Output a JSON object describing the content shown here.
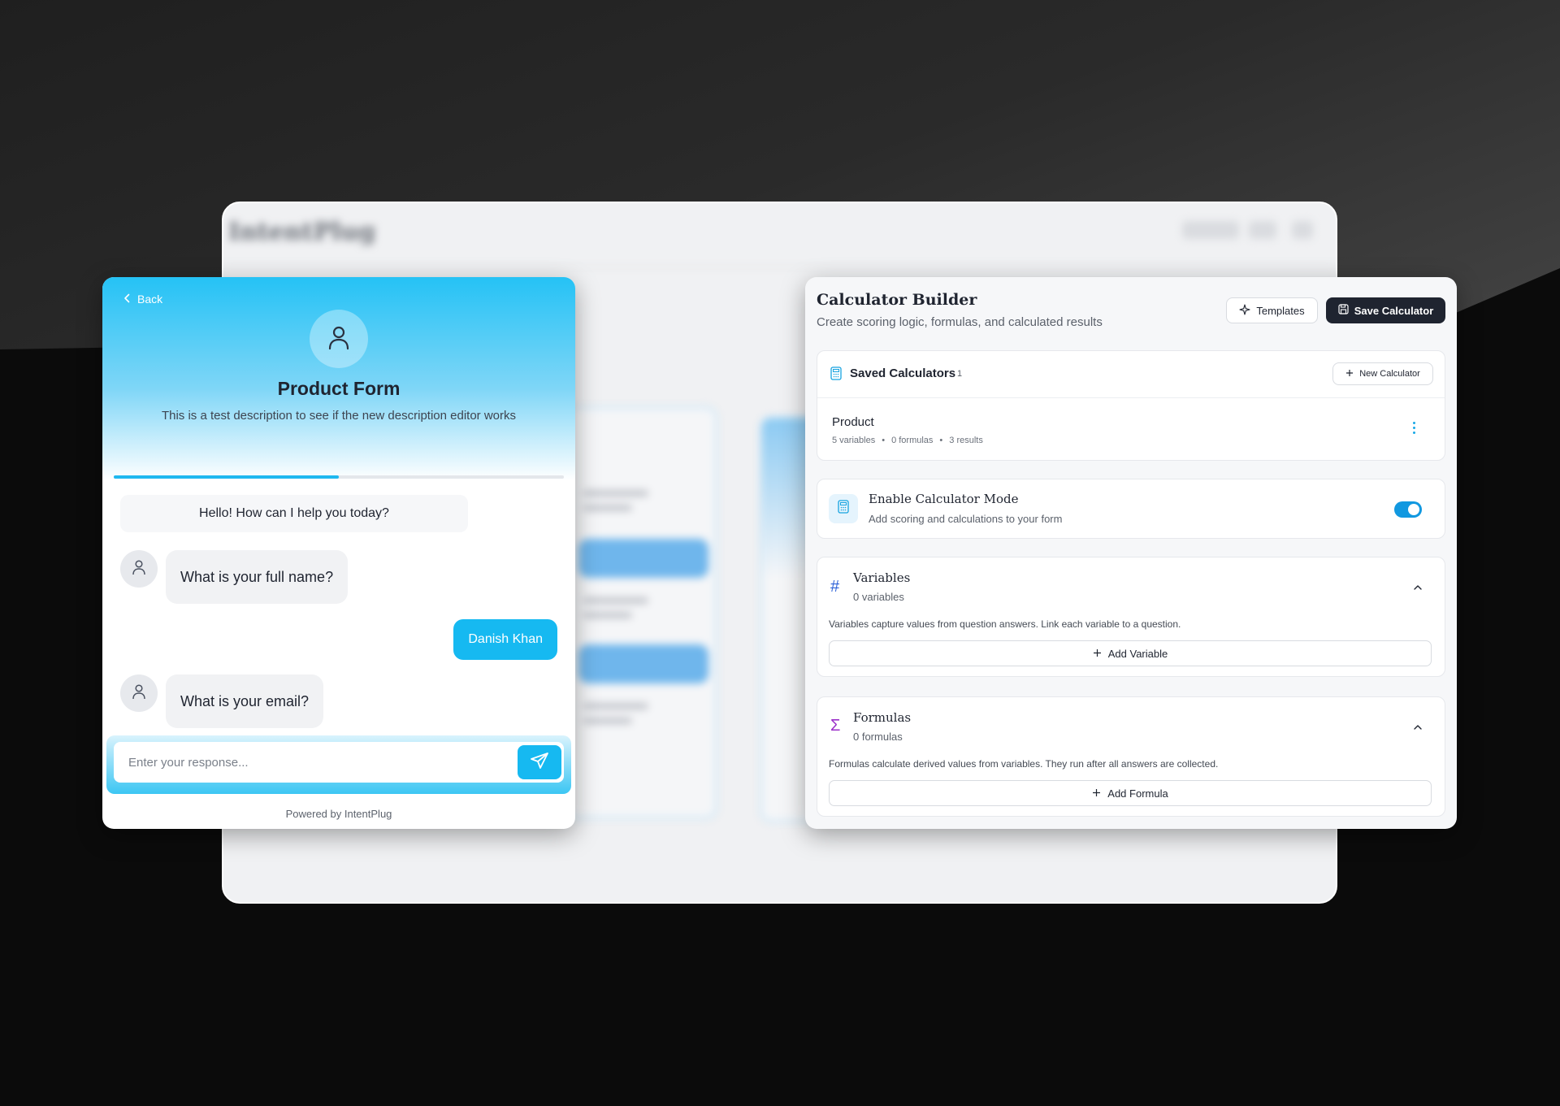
{
  "colors": {
    "accent": "#16b9f1",
    "dark_button": "#1f2430",
    "toggle_on": "#1198e0",
    "variables_icon": "#2f63d8",
    "formulas_icon": "#9b2fc9"
  },
  "backdrop": {
    "logo": "IntentPlug"
  },
  "chat": {
    "back_label": "Back",
    "back_icon": "chevron-left-icon",
    "avatar_icon": "user-icon",
    "title": "Product Form",
    "description": "This is a test description to see if the new description editor works",
    "progress": 0.5,
    "greeting": "Hello! How can I help you today?",
    "messages": [
      {
        "role": "bot",
        "text": "What is your full name?"
      },
      {
        "role": "user",
        "text": "Danish Khan"
      },
      {
        "role": "bot",
        "text": "What is your email?"
      }
    ],
    "input_placeholder": "Enter your response...",
    "send_icon": "paper-plane-icon",
    "powered_by": "Powered by IntentPlug"
  },
  "calculator": {
    "title": "Calculator Builder",
    "subtitle": "Create scoring logic, formulas, and calculated results",
    "templates_label": "Templates",
    "save_label": "Save Calculator",
    "saved": {
      "title": "Saved Calculators",
      "count": "1",
      "new_label": "New Calculator",
      "items": [
        {
          "name": "Product",
          "variables": "5 variables",
          "formulas": "0 formulas",
          "results": "3 results"
        }
      ]
    },
    "mode": {
      "title": "Enable Calculator Mode",
      "subtitle": "Add scoring and calculations to your form",
      "enabled": true
    },
    "variables": {
      "glyph": "#",
      "title": "Variables",
      "count": "0 variables",
      "description": "Variables capture values from question answers. Link each variable to a question.",
      "add_label": "Add Variable"
    },
    "formulas": {
      "glyph": "Σ",
      "title": "Formulas",
      "count": "0 formulas",
      "description": "Formulas calculate derived values from variables. They run after all answers are collected.",
      "add_label": "Add Formula"
    }
  }
}
